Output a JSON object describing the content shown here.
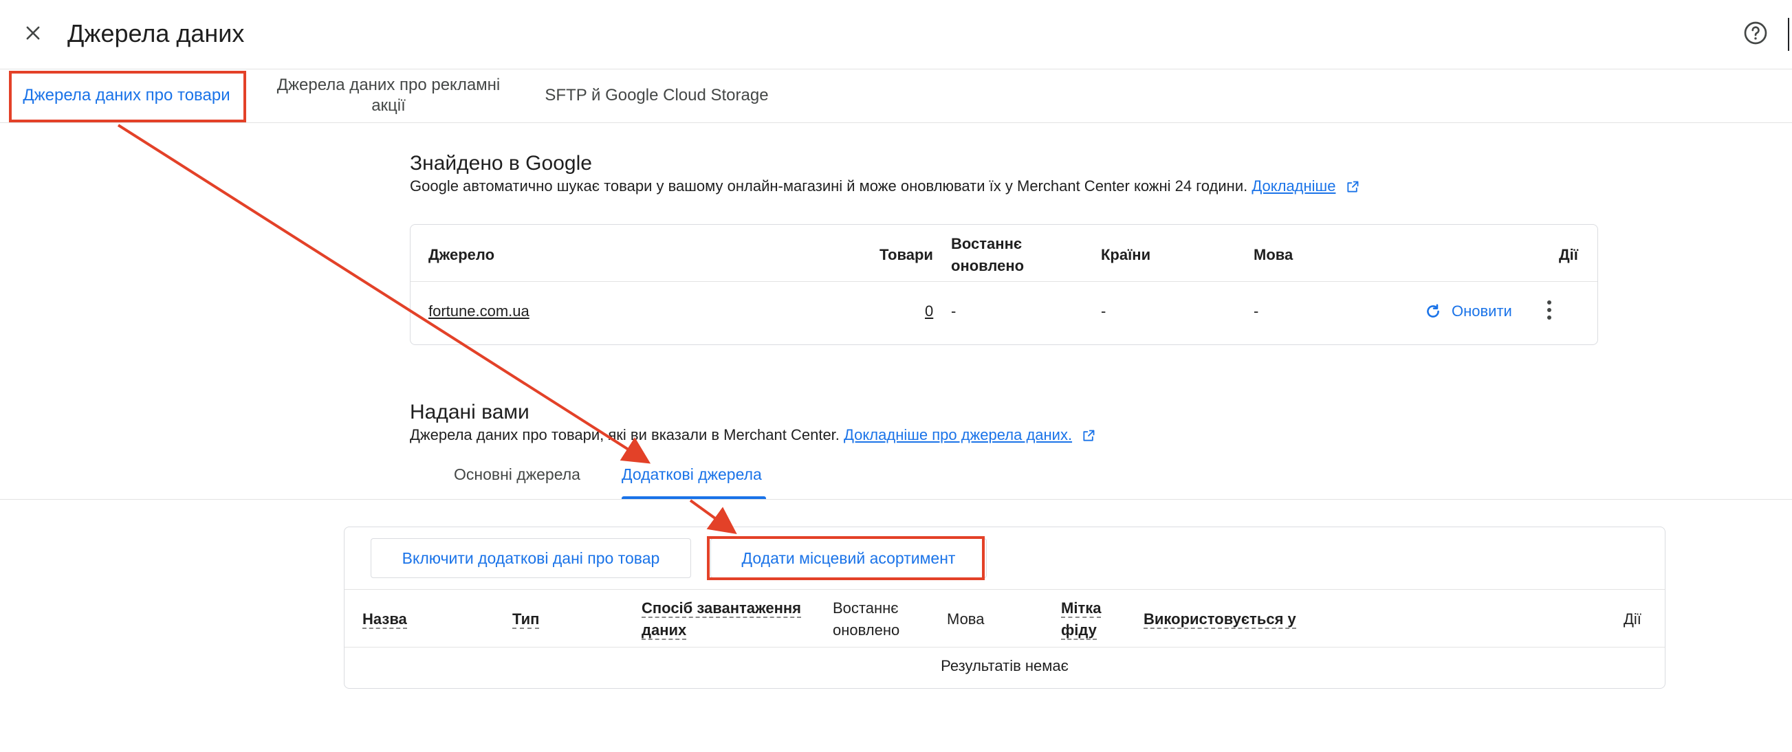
{
  "header": {
    "title": "Джерела даних",
    "close_icon": "close-icon",
    "help_icon": "help-circle-icon"
  },
  "tabs": [
    {
      "label": "Джерела даних про товари",
      "active": true
    },
    {
      "label": "Джерела даних про рекламні акції",
      "active": false
    },
    {
      "label": "SFTP й Google Cloud Storage",
      "active": false
    }
  ],
  "found": {
    "title": "Знайдено в Google",
    "description": "Google автоматично шукає товари у вашому онлайн-магазині й може оновлювати їх у Merchant Center кожні 24 години.",
    "link": "Докладніше",
    "columns": {
      "source": "Джерело",
      "products": "Товари",
      "last_updated": "Востаннє оновлено",
      "countries": "Країни",
      "language": "Мова",
      "actions": "Дії"
    },
    "row": {
      "source": "fortune.com.ua",
      "products": "0",
      "last_updated": "-",
      "countries": "-",
      "language": "-",
      "refresh_label": "Оновити"
    }
  },
  "provided": {
    "title": "Надані вами",
    "description": "Джерела даних про товари, які ви вказали в Merchant Center.",
    "link": "Докладніше про джерела даних.",
    "subtabs": [
      {
        "label": "Основні джерела",
        "active": false
      },
      {
        "label": "Додаткові джерела",
        "active": true
      }
    ],
    "buttons": {
      "include": "Включити додаткові дані про товар",
      "add_local": "Додати місцевий асортимент"
    },
    "columns": {
      "name": "Назва",
      "type": "Тип",
      "upload_method": "Спосіб завантаження даних",
      "last_updated": "Востаннє оновлено",
      "language": "Мова",
      "feed_label": "Мітка фіду",
      "used_in": "Використовується у",
      "actions": "Дії"
    },
    "empty": "Результатів немає"
  },
  "colors": {
    "accent": "#1a73e8",
    "annotation": "#e34128",
    "text": "#1f1f1f",
    "border": "#dadce0"
  }
}
